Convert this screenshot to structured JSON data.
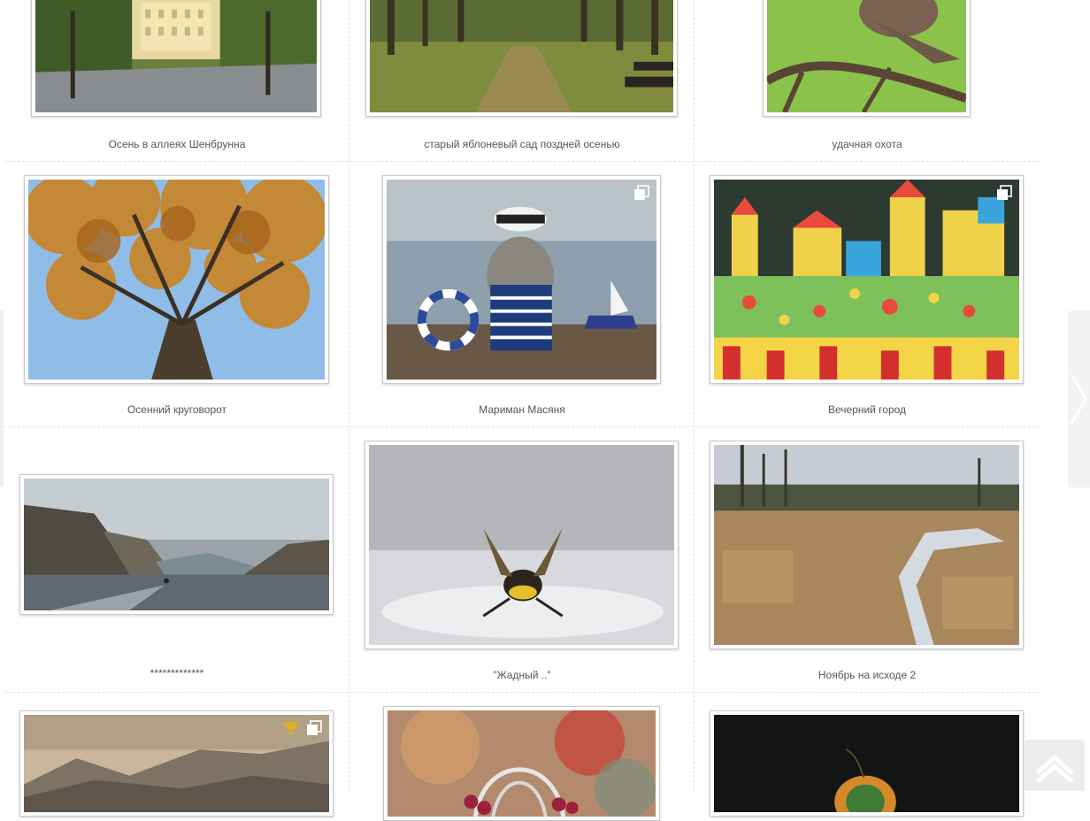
{
  "gallery": {
    "items": [
      {
        "caption": "Осень в аллеях Шенбрунна",
        "badges": []
      },
      {
        "caption": "старый яблоневый сад поздней осенью",
        "badges": []
      },
      {
        "caption": "удачная охота",
        "badges": []
      },
      {
        "caption": "Осенний круговорот",
        "badges": []
      },
      {
        "caption": "Мариман Масяня",
        "badges": [
          "gallery-icon"
        ]
      },
      {
        "caption": "Вечерний город",
        "badges": [
          "gallery-icon"
        ]
      },
      {
        "caption": "*************",
        "badges": []
      },
      {
        "caption": "\"Жадный ..\"",
        "badges": []
      },
      {
        "caption": "Ноябрь на исходе 2",
        "badges": []
      },
      {
        "caption": "",
        "badges": [
          "trophy-icon",
          "gallery-icon"
        ]
      },
      {
        "caption": "",
        "badges": []
      },
      {
        "caption": "",
        "badges": []
      }
    ]
  },
  "navigation": {
    "prev_icon": "chevron-left-icon",
    "next_icon": "chevron-right-icon",
    "scroll_top_icon": "chevron-up-icon"
  },
  "colors": {
    "caption_text": "#555555",
    "divider": "#e2e2e2",
    "side_tab": "#f3f3f3"
  }
}
